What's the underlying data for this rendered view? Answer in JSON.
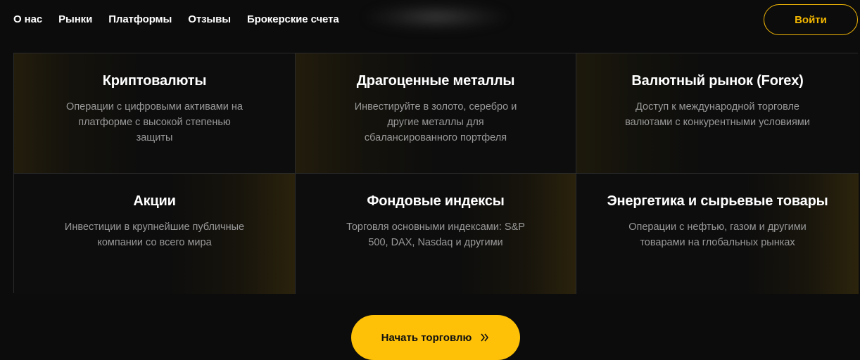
{
  "nav": {
    "items": [
      {
        "label": "О нас"
      },
      {
        "label": "Рынки"
      },
      {
        "label": "Платформы"
      },
      {
        "label": "Отзывы"
      },
      {
        "label": "Брокерские счета"
      }
    ]
  },
  "header": {
    "login_label": "Войти"
  },
  "markets": [
    {
      "title": "Криптовалюты",
      "desc": "Операции с цифровыми активами на платформе с высокой степенью защиты"
    },
    {
      "title": "Драгоценные металлы",
      "desc": "Инвестируйте в золото, серебро и другие металлы для сбалансированного портфеля"
    },
    {
      "title": "Валютный рынок (Forex)",
      "desc": "Доступ к международной торговле валютами с конкурентными условиями"
    },
    {
      "title": "Акции",
      "desc": "Инвестиции в крупнейшие публичные компании со всего мира"
    },
    {
      "title": "Фондовые индексы",
      "desc": "Торговля основными индексами: S&P 500, DAX, Nasdaq и другими"
    },
    {
      "title": "Энергетика и сырьевые товары",
      "desc": "Операции с нефтью, газом и другими товарами на глобальных рынках"
    }
  ],
  "cta": {
    "label": "Начать торговлю",
    "icon": "double-chevron-right-icon"
  },
  "colors": {
    "accent": "#fec107",
    "background": "#0c0c0c",
    "text_muted": "#9a9a9a"
  }
}
